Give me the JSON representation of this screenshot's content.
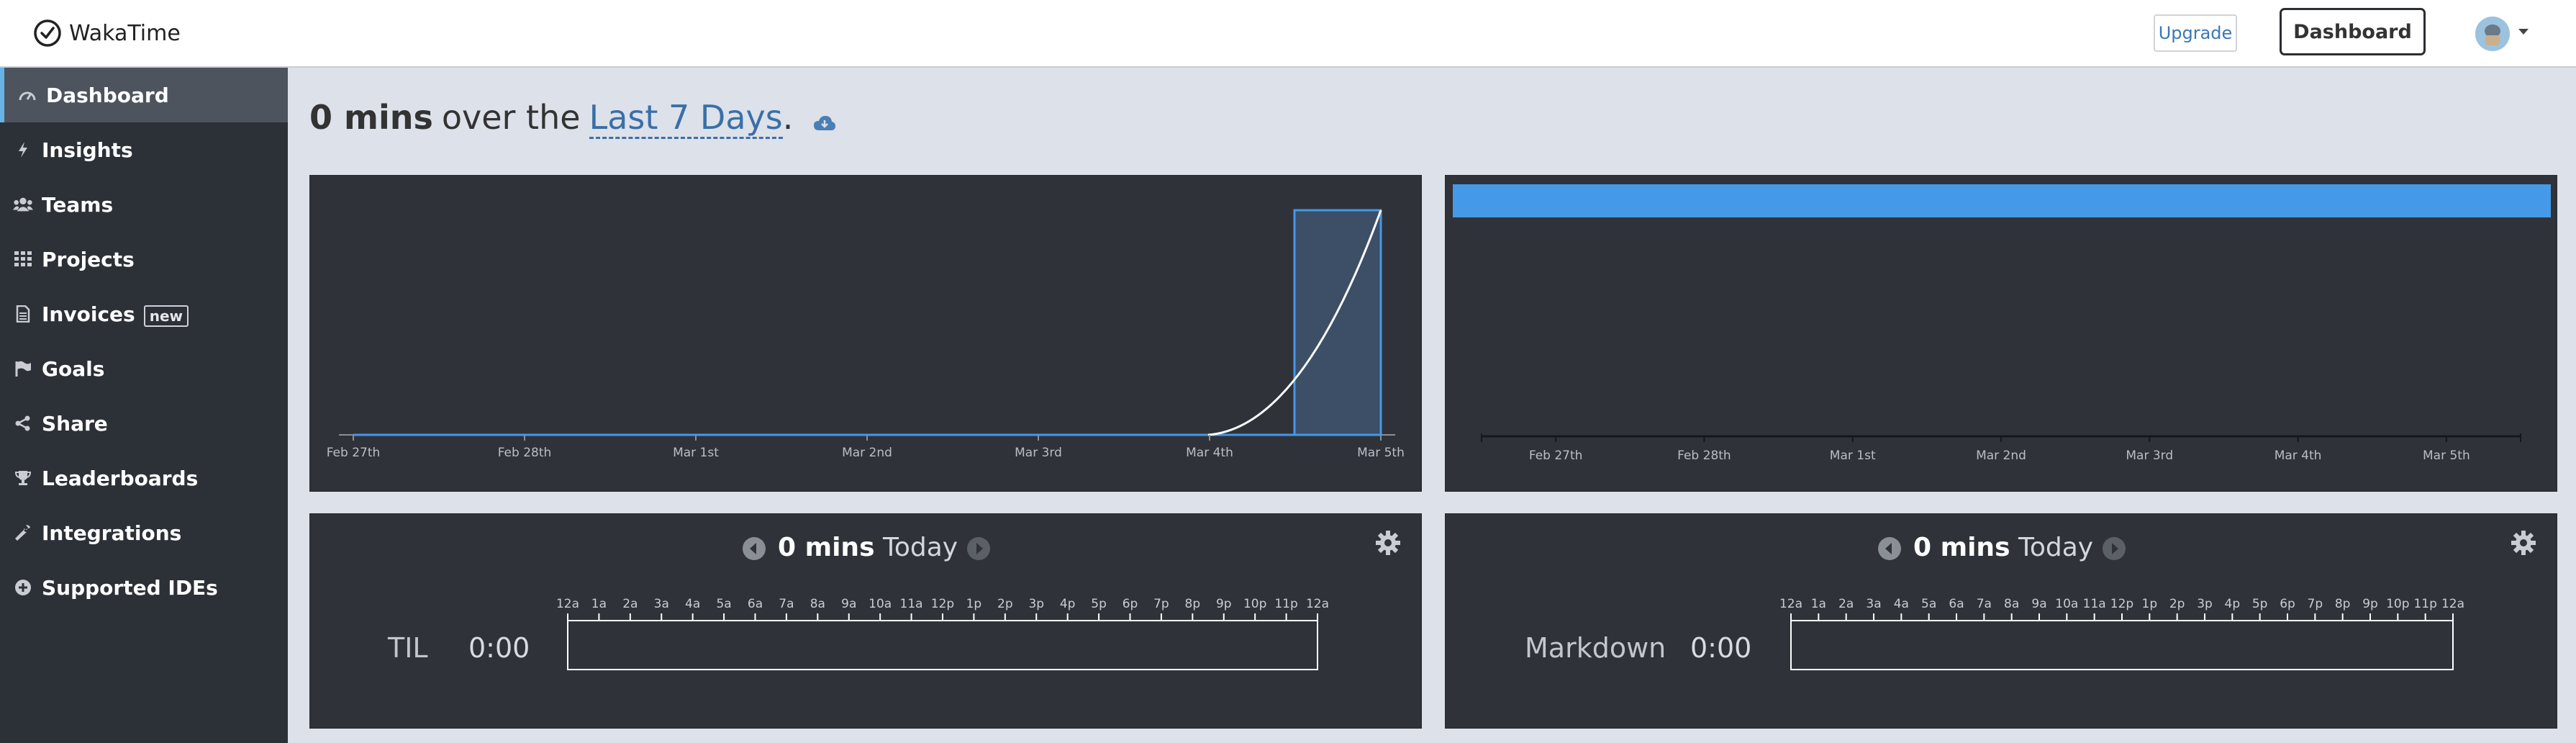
{
  "app": {
    "name": "WakaTime"
  },
  "header": {
    "upgrade_label": "Upgrade",
    "dashboard_label": "Dashboard"
  },
  "sidebar": {
    "items": [
      {
        "label": "Dashboard",
        "icon": "dashboard-icon",
        "active": true
      },
      {
        "label": "Insights",
        "icon": "bolt-icon"
      },
      {
        "label": "Teams",
        "icon": "users-icon"
      },
      {
        "label": "Projects",
        "icon": "grid-icon"
      },
      {
        "label": "Invoices",
        "icon": "file-icon",
        "badge": "new"
      },
      {
        "label": "Goals",
        "icon": "flag-icon"
      },
      {
        "label": "Share",
        "icon": "share-icon"
      },
      {
        "label": "Leaderboards",
        "icon": "trophy-icon"
      },
      {
        "label": "Integrations",
        "icon": "wrench-icon"
      },
      {
        "label": "Supported IDEs",
        "icon": "plus-circle-icon"
      }
    ]
  },
  "main": {
    "heading": {
      "total": "0 mins",
      "middle": "over the",
      "range": "Last 7 Days",
      "end": "."
    }
  },
  "colors": {
    "accent": "#4499e9",
    "panel": "#2f3339",
    "sidebar": "#2c3037",
    "link": "#3a6fa8"
  },
  "chart_data": [
    {
      "type": "area",
      "categories": [
        "Feb 27th",
        "Feb 28th",
        "Mar 1st",
        "Mar 2nd",
        "Mar 3rd",
        "Mar 4th",
        "Mar 5th"
      ],
      "values": [
        0,
        0,
        0,
        0,
        0,
        0,
        0
      ],
      "highlight_category": "Mar 5th"
    },
    {
      "type": "bar",
      "categories": [
        "Feb 27th",
        "Feb 28th",
        "Mar 1st",
        "Mar 2nd",
        "Mar 3rd",
        "Mar 4th",
        "Mar 5th"
      ],
      "values": [
        0,
        0,
        0,
        0,
        0,
        0,
        0
      ]
    }
  ],
  "today": {
    "total": "0 mins",
    "label": "Today",
    "hours": [
      "12a",
      "1a",
      "2a",
      "3a",
      "4a",
      "5a",
      "6a",
      "7a",
      "8a",
      "9a",
      "10a",
      "11a",
      "12p",
      "1p",
      "2p",
      "3p",
      "4p",
      "5p",
      "6p",
      "7p",
      "8p",
      "9p",
      "10p",
      "11p",
      "12a"
    ],
    "panels": [
      {
        "row_label": "TIL",
        "time": "0:00"
      },
      {
        "row_label": "Markdown",
        "time": "0:00"
      }
    ]
  }
}
